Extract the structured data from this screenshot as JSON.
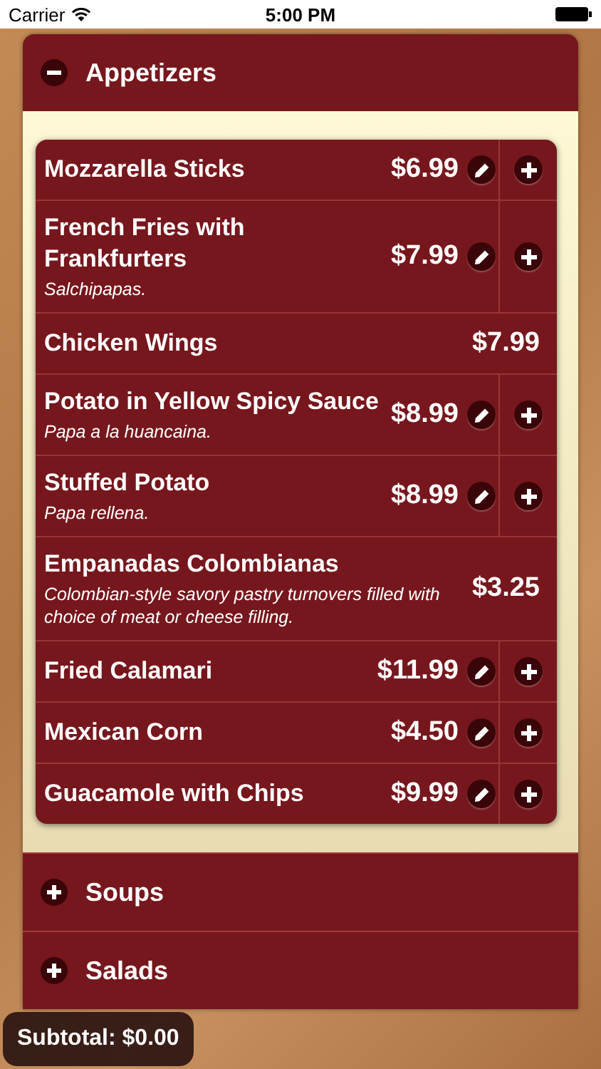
{
  "status_bar": {
    "carrier": "Carrier",
    "time": "5:00 PM"
  },
  "categories": [
    {
      "name": "Appetizers",
      "expanded": true,
      "items": [
        {
          "kind": "orderable",
          "name": "Mozzarella Sticks",
          "price": "$6.99"
        },
        {
          "kind": "orderable",
          "name": "French Fries with Frankfurters",
          "description": "Salchipapas.",
          "price": "$7.99"
        },
        {
          "kind": "plain",
          "name": "Chicken Wings",
          "price": "$7.99"
        },
        {
          "kind": "orderable",
          "name": "Potato in Yellow Spicy Sauce",
          "description": "Papa a la huancaina.",
          "price": "$8.99"
        },
        {
          "kind": "orderable",
          "name": "Stuffed Potato",
          "description": "Papa rellena.",
          "price": "$8.99"
        },
        {
          "kind": "plain",
          "name": "Empanadas Colombianas",
          "description": "Colombian-style savory pastry turnovers filled with choice of meat or cheese filling.",
          "price": "$3.25"
        },
        {
          "kind": "orderable",
          "name": "Fried Calamari",
          "price": "$11.99"
        },
        {
          "kind": "orderable",
          "name": "Mexican Corn",
          "price": "$4.50"
        },
        {
          "kind": "orderable",
          "name": "Guacamole with Chips",
          "price": "$9.99"
        }
      ]
    },
    {
      "name": "Soups",
      "expanded": false
    },
    {
      "name": "Salads",
      "expanded": false
    }
  ],
  "subtotal": "Subtotal: $0.00"
}
